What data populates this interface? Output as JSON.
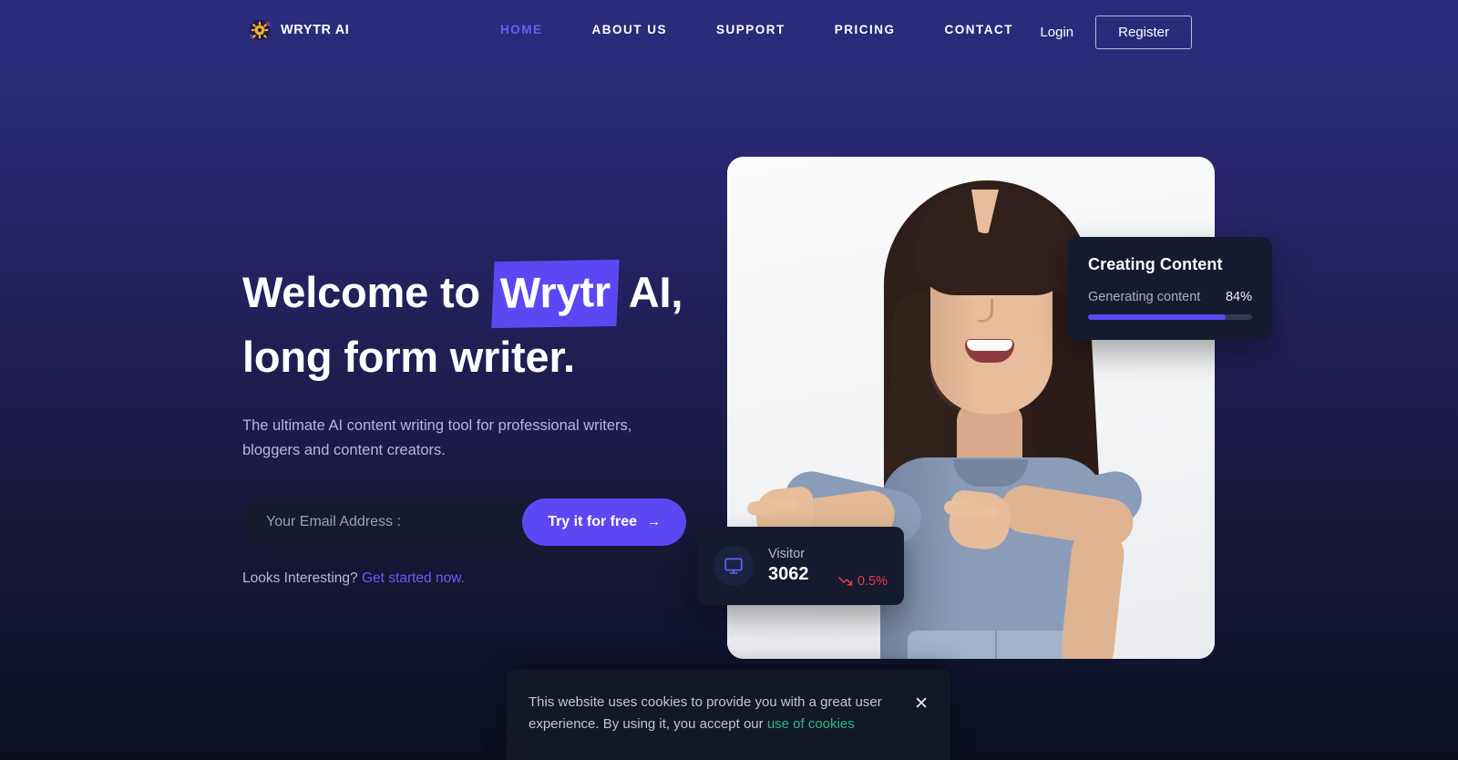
{
  "brand": {
    "name": "WRYTR AI",
    "icon": "gear-sun-icon"
  },
  "nav": {
    "links": [
      {
        "label": "HOME",
        "active": true
      },
      {
        "label": "ABOUT US",
        "active": false
      },
      {
        "label": "SUPPORT",
        "active": false
      },
      {
        "label": "PRICING",
        "active": false
      },
      {
        "label": "CONTACT",
        "active": false
      }
    ],
    "login_label": "Login",
    "register_label": "Register"
  },
  "hero": {
    "headline_part1": "Welcome to",
    "headline_highlight": "Wrytr",
    "headline_part2": "AI,",
    "headline_line2": "long form writer.",
    "subtext": "The ultimate AI content writing tool for professional writers, bloggers and content creators.",
    "email_placeholder": "Your Email Address :",
    "email_value": "",
    "cta_label": "Try it for free",
    "cta_arrow": "→",
    "interesting_prefix": "Looks Interesting? ",
    "interesting_link": "Get started now."
  },
  "creating_card": {
    "title": "Creating Content",
    "progress_label": "Generating content",
    "progress_percent_text": "84%",
    "progress_value": 84,
    "accent_color": "#5b48f2"
  },
  "visitor_card": {
    "icon": "monitor-icon",
    "label": "Visitor",
    "value": "3062",
    "delta_text": "0.5%",
    "delta_direction": "down",
    "delta_color": "#e03a4e"
  },
  "cookie_banner": {
    "text_part1": "This website uses cookies to provide you with a great user experience. By using it, you accept our ",
    "link_label": "use of cookies",
    "close_label": "✕",
    "link_color": "#2bb789"
  },
  "theme": {
    "bg_top": "#2b2b7d",
    "bg_bottom": "#0b0f21",
    "accent": "#5b48f2",
    "nav_active": "#6a5cf5"
  }
}
